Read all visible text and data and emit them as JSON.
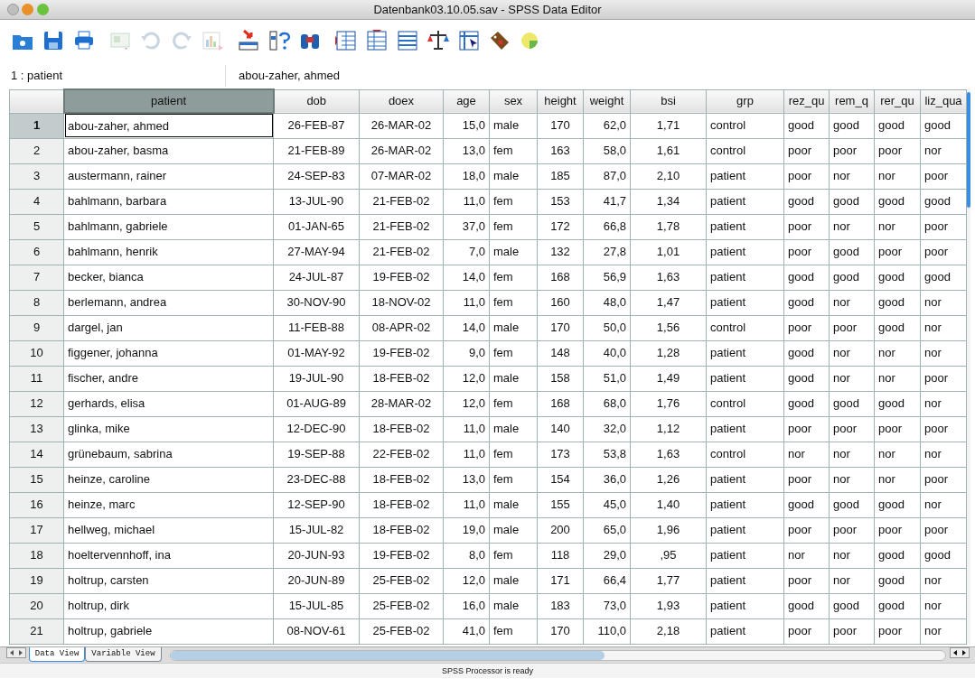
{
  "window": {
    "title": "Datenbank03.10.05.sav - SPSS Data Editor"
  },
  "toolbar": [
    {
      "kind": "open",
      "disabled": false
    },
    {
      "kind": "save",
      "disabled": false
    },
    {
      "kind": "print",
      "disabled": false
    },
    {
      "kind": "dialog",
      "disabled": true
    },
    {
      "kind": "undo",
      "disabled": true
    },
    {
      "kind": "redo",
      "disabled": true
    },
    {
      "kind": "chart",
      "disabled": true
    },
    {
      "kind": "goto",
      "disabled": false
    },
    {
      "kind": "variables",
      "disabled": false
    },
    {
      "kind": "find",
      "disabled": false
    },
    {
      "kind": "insert_case",
      "disabled": false
    },
    {
      "kind": "insert_variable",
      "disabled": false
    },
    {
      "kind": "split",
      "disabled": false
    },
    {
      "kind": "weight",
      "disabled": false
    },
    {
      "kind": "select",
      "disabled": false
    },
    {
      "kind": "labels",
      "disabled": false
    },
    {
      "kind": "sets",
      "disabled": false
    }
  ],
  "cell_reference": "1 : patient",
  "cell_value": "abou-zaher, ahmed",
  "columns": [
    {
      "name": "patient",
      "selected": true
    },
    {
      "name": "dob",
      "selected": false
    },
    {
      "name": "doex",
      "selected": false
    },
    {
      "name": "age",
      "selected": false
    },
    {
      "name": "sex",
      "selected": false
    },
    {
      "name": "height",
      "selected": false
    },
    {
      "name": "weight",
      "selected": false
    },
    {
      "name": "bsi",
      "selected": false
    },
    {
      "name": "grp",
      "selected": false
    },
    {
      "name": "rez_qu",
      "selected": false
    },
    {
      "name": "rem_q",
      "selected": false
    },
    {
      "name": "rer_qu",
      "selected": false
    },
    {
      "name": "liz_qua",
      "selected": false
    }
  ],
  "rows": [
    {
      "number": "1",
      "selected": true,
      "cells": [
        "abou-zaher, ahmed",
        "26-FEB-87",
        "26-MAR-02",
        "15,0",
        "male",
        "170",
        "62,0",
        "1,71",
        "control",
        "good",
        "good",
        "good",
        "good"
      ]
    },
    {
      "number": "2",
      "selected": false,
      "cells": [
        "abou-zaher, basma",
        "21-FEB-89",
        "26-MAR-02",
        "13,0",
        "fem",
        "163",
        "58,0",
        "1,61",
        "control",
        "poor",
        "poor",
        "poor",
        "nor"
      ]
    },
    {
      "number": "3",
      "selected": false,
      "cells": [
        "austermann, rainer",
        "24-SEP-83",
        "07-MAR-02",
        "18,0",
        "male",
        "185",
        "87,0",
        "2,10",
        "patient",
        "poor",
        "nor",
        "nor",
        "poor"
      ]
    },
    {
      "number": "4",
      "selected": false,
      "cells": [
        "bahlmann, barbara",
        "13-JUL-90",
        "21-FEB-02",
        "11,0",
        "fem",
        "153",
        "41,7",
        "1,34",
        "patient",
        "good",
        "good",
        "good",
        "good"
      ]
    },
    {
      "number": "5",
      "selected": false,
      "cells": [
        "bahlmann, gabriele",
        "01-JAN-65",
        "21-FEB-02",
        "37,0",
        "fem",
        "172",
        "66,8",
        "1,78",
        "patient",
        "poor",
        "nor",
        "nor",
        "poor"
      ]
    },
    {
      "number": "6",
      "selected": false,
      "cells": [
        "bahlmann, henrik",
        "27-MAY-94",
        "21-FEB-02",
        "7,0",
        "male",
        "132",
        "27,8",
        "1,01",
        "patient",
        "poor",
        "good",
        "poor",
        "poor"
      ]
    },
    {
      "number": "7",
      "selected": false,
      "cells": [
        "becker, bianca",
        "24-JUL-87",
        "19-FEB-02",
        "14,0",
        "fem",
        "168",
        "56,9",
        "1,63",
        "patient",
        "good",
        "good",
        "good",
        "good"
      ]
    },
    {
      "number": "8",
      "selected": false,
      "cells": [
        "berlemann, andrea",
        "30-NOV-90",
        "18-NOV-02",
        "11,0",
        "fem",
        "160",
        "48,0",
        "1,47",
        "patient",
        "good",
        "nor",
        "good",
        "nor"
      ]
    },
    {
      "number": "9",
      "selected": false,
      "cells": [
        "dargel, jan",
        "11-FEB-88",
        "08-APR-02",
        "14,0",
        "male",
        "170",
        "50,0",
        "1,56",
        "control",
        "poor",
        "poor",
        "good",
        "nor"
      ]
    },
    {
      "number": "10",
      "selected": false,
      "cells": [
        "figgener, johanna",
        "01-MAY-92",
        "19-FEB-02",
        "9,0",
        "fem",
        "148",
        "40,0",
        "1,28",
        "patient",
        "good",
        "nor",
        "nor",
        "nor"
      ]
    },
    {
      "number": "11",
      "selected": false,
      "cells": [
        "fischer, andre",
        "19-JUL-90",
        "18-FEB-02",
        "12,0",
        "male",
        "158",
        "51,0",
        "1,49",
        "patient",
        "good",
        "nor",
        "nor",
        "poor"
      ]
    },
    {
      "number": "12",
      "selected": false,
      "cells": [
        "gerhards, elisa",
        "01-AUG-89",
        "28-MAR-02",
        "12,0",
        "fem",
        "168",
        "68,0",
        "1,76",
        "control",
        "good",
        "good",
        "good",
        "nor"
      ]
    },
    {
      "number": "13",
      "selected": false,
      "cells": [
        "glinka, mike",
        "12-DEC-90",
        "18-FEB-02",
        "11,0",
        "male",
        "140",
        "32,0",
        "1,12",
        "patient",
        "poor",
        "poor",
        "poor",
        "poor"
      ]
    },
    {
      "number": "14",
      "selected": false,
      "cells": [
        "grünebaum, sabrina",
        "19-SEP-88",
        "22-FEB-02",
        "11,0",
        "fem",
        "173",
        "53,8",
        "1,63",
        "control",
        "nor",
        "nor",
        "nor",
        "nor"
      ]
    },
    {
      "number": "15",
      "selected": false,
      "cells": [
        "heinze, caroline",
        "23-DEC-88",
        "18-FEB-02",
        "13,0",
        "fem",
        "154",
        "36,0",
        "1,26",
        "patient",
        "poor",
        "nor",
        "nor",
        "poor"
      ]
    },
    {
      "number": "16",
      "selected": false,
      "cells": [
        "heinze, marc",
        "12-SEP-90",
        "18-FEB-02",
        "11,0",
        "male",
        "155",
        "45,0",
        "1,40",
        "patient",
        "good",
        "good",
        "good",
        "nor"
      ]
    },
    {
      "number": "17",
      "selected": false,
      "cells": [
        "hellweg, michael",
        "15-JUL-82",
        "18-FEB-02",
        "19,0",
        "male",
        "200",
        "65,0",
        "1,96",
        "patient",
        "poor",
        "poor",
        "poor",
        "poor"
      ]
    },
    {
      "number": "18",
      "selected": false,
      "cells": [
        "hoeltervennhoff, ina",
        "20-JUN-93",
        "19-FEB-02",
        "8,0",
        "fem",
        "118",
        "29,0",
        ",95",
        "patient",
        "nor",
        "nor",
        "good",
        "good"
      ]
    },
    {
      "number": "19",
      "selected": false,
      "cells": [
        "holtrup, carsten",
        "20-JUN-89",
        "25-FEB-02",
        "12,0",
        "male",
        "171",
        "66,4",
        "1,77",
        "patient",
        "poor",
        "nor",
        "good",
        "nor"
      ]
    },
    {
      "number": "20",
      "selected": false,
      "cells": [
        "holtrup, dirk",
        "15-JUL-85",
        "25-FEB-02",
        "16,0",
        "male",
        "183",
        "73,0",
        "1,93",
        "patient",
        "good",
        "good",
        "good",
        "nor"
      ]
    },
    {
      "number": "21",
      "selected": false,
      "cells": [
        "holtrup, gabriele",
        "08-NOV-61",
        "25-FEB-02",
        "41,0",
        "fem",
        "170",
        "110,0",
        "2,18",
        "patient",
        "poor",
        "poor",
        "poor",
        "nor"
      ]
    }
  ],
  "view_tabs": [
    {
      "label": "Data View",
      "selected": true
    },
    {
      "label": "Variable View",
      "selected": false
    }
  ],
  "status_bar": "SPSS Processor  is ready"
}
